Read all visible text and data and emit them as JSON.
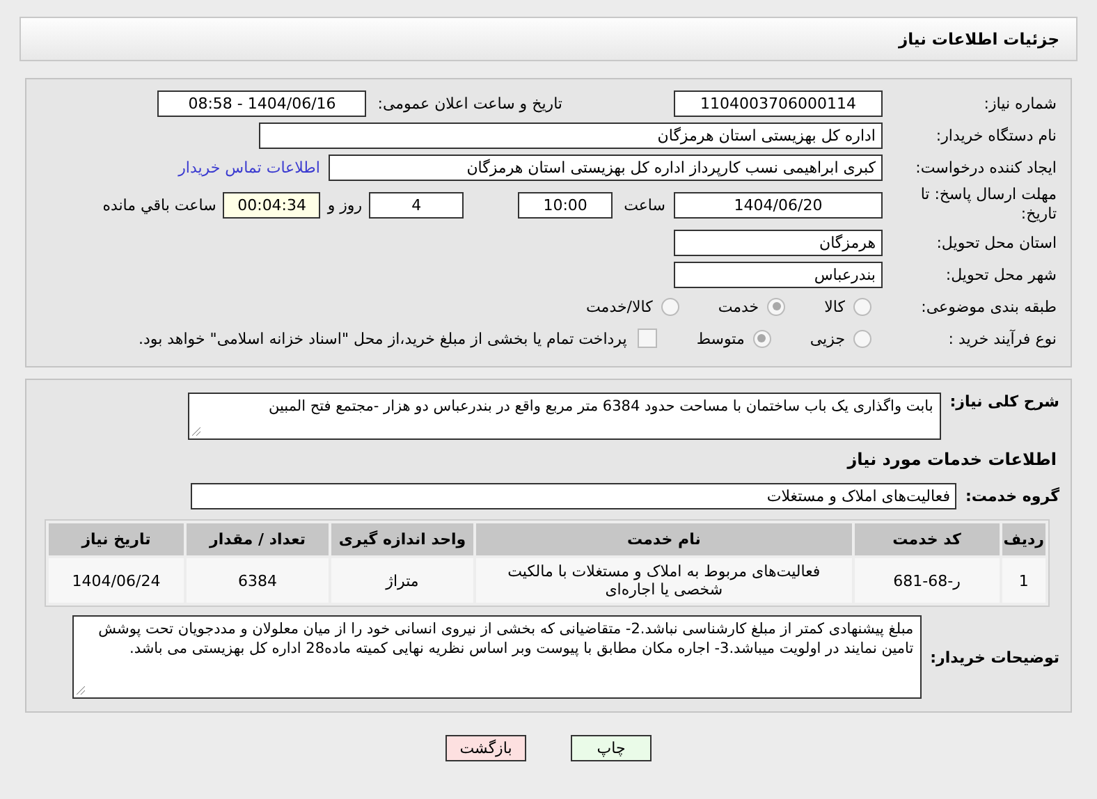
{
  "header": {
    "title": "جزئیات اطلاعات نیاز"
  },
  "details": {
    "need_number": {
      "label": "شماره نیاز:",
      "value": "1104003706000114"
    },
    "announce": {
      "label": "تاریخ و ساعت اعلان عمومی:",
      "value": "1404/06/16 - 08:58"
    },
    "buyer_org": {
      "label": "نام دستگاه خریدار:",
      "value": "اداره کل بهزیستی استان هرمزگان"
    },
    "requester": {
      "label": "ایجاد کننده درخواست:",
      "value": "کبری  ابراهیمی نسب کارپرداز اداره کل بهزیستی استان هرمزگان",
      "link": "اطلاعات تماس خریدار"
    },
    "deadline": {
      "label": "مهلت ارسال پاسخ: تا تاریخ:",
      "date": "1404/06/20",
      "time_label": "ساعت",
      "time": "10:00",
      "days": "4",
      "days_label": "روز و",
      "remaining": "00:04:34",
      "remaining_label": "ساعت باقي مانده"
    },
    "province": {
      "label": "استان محل تحویل:",
      "value": "هرمزگان"
    },
    "city": {
      "label": "شهر محل تحویل:",
      "value": "بندرعباس"
    },
    "category": {
      "label": "طبقه بندی موضوعی:",
      "options": [
        {
          "label": "کالا",
          "selected": false
        },
        {
          "label": "خدمت",
          "selected": true
        },
        {
          "label": "کالا/خدمت",
          "selected": false
        }
      ]
    },
    "process": {
      "label": "نوع فرآیند خرید :",
      "options": [
        {
          "label": "جزیی",
          "selected": false
        },
        {
          "label": "متوسط",
          "selected": true
        }
      ],
      "payment": {
        "label": "پرداخت تمام یا بخشی از مبلغ خرید،از محل \"اسناد خزانه اسلامی\" خواهد بود.",
        "checked": false
      }
    }
  },
  "services": {
    "description": {
      "label": "شرح کلی نیاز:",
      "value": "بابت واگذاری یک باب ساختمان با مساحت حدود 6384 متر مربع واقع در بندرعباس دو هزار -مجتمع فتح المبین"
    },
    "heading": "اطلاعات خدمات مورد نیاز",
    "group": {
      "label": "گروه خدمت:",
      "value": "فعالیت‌های  املاک و مستغلات"
    },
    "table": {
      "columns": [
        "ردیف",
        "کد خدمت",
        "نام خدمت",
        "واحد اندازه گیری",
        "تعداد / مقدار",
        "تاریخ نیاز"
      ],
      "rows": [
        [
          "1",
          "ر-68-681",
          "فعالیت‌های مربوط به املاک و مستغلات با مالکیت شخصی یا اجاره‌ای",
          "متراژ",
          "6384",
          "1404/06/24"
        ]
      ]
    },
    "notes": {
      "label": "توضیحات خریدار:",
      "value": "مبلغ پیشنهادی کمتر از مبلغ کارشناسی نباشد.2- متقاضیانی که بخشی از نیروی انسانی خود را از میان معلولان و مددجویان تحت پوشش تامین نمایند در اولویت میباشد.3-  اجاره مکان  مطابق با پیوست وبر اساس نظریه نهایی کمیته ماده28 اداره کل بهزیستی می باشد."
    }
  },
  "buttons": [
    {
      "label": "چاپ",
      "kind": "print"
    },
    {
      "label": "بازگشت",
      "kind": "back"
    }
  ]
}
